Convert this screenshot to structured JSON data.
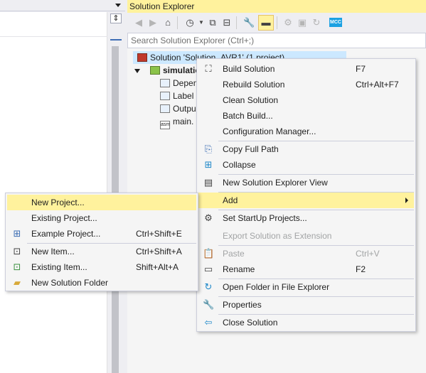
{
  "solution_explorer": {
    "title": "Solution Explorer",
    "search_placeholder": "Search Solution Explorer (Ctrl+;)",
    "toolbar": {
      "mcc_label": "MCC"
    },
    "tree": {
      "solution": "Solution 'Solution_AVR1' (1 project)",
      "project": "simulatio",
      "items": [
        "Depen",
        "Label",
        "Outpu",
        "main."
      ]
    }
  },
  "context_menu": {
    "items": [
      {
        "label": "Build Solution",
        "shortcut": "F7",
        "icon": "build-icon"
      },
      {
        "label": "Rebuild Solution",
        "shortcut": "Ctrl+Alt+F7",
        "icon": ""
      },
      {
        "label": "Clean Solution",
        "shortcut": "",
        "icon": ""
      },
      {
        "label": "Batch Build...",
        "shortcut": "",
        "icon": ""
      },
      {
        "label": "Configuration Manager...",
        "shortcut": "",
        "icon": ""
      },
      {
        "label": "Copy Full Path",
        "shortcut": "",
        "icon": "copy-icon"
      },
      {
        "label": "Collapse",
        "shortcut": "",
        "icon": "collapse-icon"
      },
      {
        "label": "New Solution Explorer View",
        "shortcut": "",
        "icon": "new-view-icon"
      },
      {
        "label": "Add",
        "shortcut": "",
        "icon": ""
      },
      {
        "label": "Set StartUp Projects...",
        "shortcut": "",
        "icon": "gear-icon"
      },
      {
        "label": "Export Solution as Extension",
        "shortcut": "",
        "icon": ""
      },
      {
        "label": "Paste",
        "shortcut": "Ctrl+V",
        "icon": "paste-icon"
      },
      {
        "label": "Rename",
        "shortcut": "F2",
        "icon": "rename-icon"
      },
      {
        "label": "Open Folder in File Explorer",
        "shortcut": "",
        "icon": "open-folder-icon"
      },
      {
        "label": "Properties",
        "shortcut": "",
        "icon": "wrench-icon"
      },
      {
        "label": "Close Solution",
        "shortcut": "",
        "icon": "close-solution-icon"
      }
    ]
  },
  "add_submenu": {
    "items": [
      {
        "label": "New Project...",
        "shortcut": ""
      },
      {
        "label": "Existing Project...",
        "shortcut": ""
      },
      {
        "label": "Example Project...",
        "shortcut": "Ctrl+Shift+E"
      },
      {
        "label": "New Item...",
        "shortcut": "Ctrl+Shift+A"
      },
      {
        "label": "Existing Item...",
        "shortcut": "Shift+Alt+A"
      },
      {
        "label": "New Solution Folder",
        "shortcut": ""
      }
    ]
  },
  "colors": {
    "highlight": "#fff29d",
    "menu_bg": "#f5f5f5",
    "border": "#cccedb"
  }
}
